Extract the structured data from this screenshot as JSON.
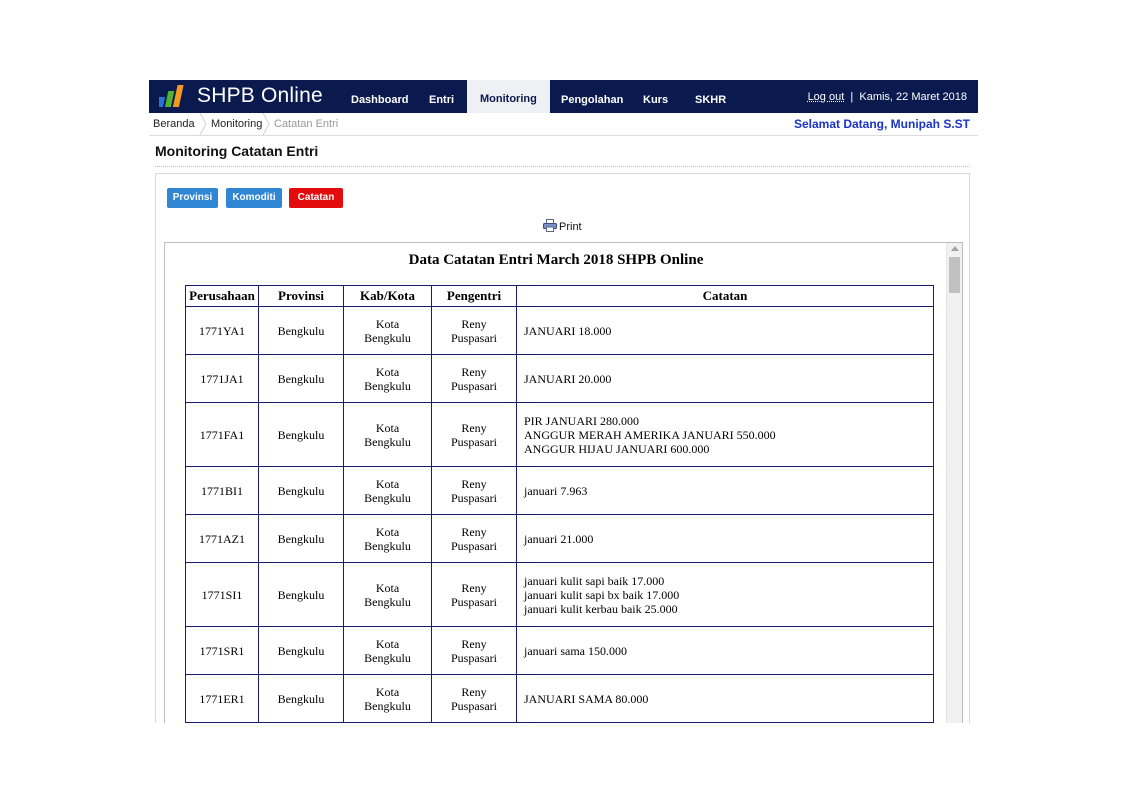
{
  "header": {
    "app_title": "SHPB Online",
    "nav": [
      "Dashboard",
      "Entri",
      "Monitoring",
      "Pengolahan",
      "Kurs",
      "SKHR"
    ],
    "active_nav": "Monitoring",
    "logout_label": "Log out",
    "separator": "|",
    "date": "Kamis, 22 Maret 2018"
  },
  "breadcrumb": [
    "Beranda",
    "Monitoring",
    "Catatan Entri"
  ],
  "welcome": "Selamat Datang, Munipah S.ST",
  "page_title": "Monitoring Catatan Entri",
  "tabs": [
    {
      "label": "Provinsi",
      "color": "#2f86d3"
    },
    {
      "label": "Komoditi",
      "color": "#2f86d3"
    },
    {
      "label": "Catatan",
      "color": "#e30b0b"
    }
  ],
  "print_label": "Print",
  "report": {
    "title": "Data Catatan Entri March 2018 SHPB Online",
    "columns": [
      "Perusahaan",
      "Provinsi",
      "Kab/Kota",
      "Pengentri",
      "Catatan"
    ],
    "rows": [
      {
        "perusahaan": "1771YA1",
        "provinsi": "Bengkulu",
        "kota": [
          "Kota",
          "Bengkulu"
        ],
        "pengentri": [
          "Reny",
          "Puspasari"
        ],
        "catatan": [
          "JANUARI 18.000"
        ]
      },
      {
        "perusahaan": "1771JA1",
        "provinsi": "Bengkulu",
        "kota": [
          "Kota",
          "Bengkulu"
        ],
        "pengentri": [
          "Reny",
          "Puspasari"
        ],
        "catatan": [
          "JANUARI 20.000"
        ]
      },
      {
        "perusahaan": "1771FA1",
        "provinsi": "Bengkulu",
        "kota": [
          "Kota",
          "Bengkulu"
        ],
        "pengentri": [
          "Reny",
          "Puspasari"
        ],
        "catatan": [
          "PIR JANUARI 280.000",
          "ANGGUR MERAH AMERIKA JANUARI 550.000",
          "ANGGUR HIJAU JANUARI 600.000"
        ]
      },
      {
        "perusahaan": "1771BI1",
        "provinsi": "Bengkulu",
        "kota": [
          "Kota",
          "Bengkulu"
        ],
        "pengentri": [
          "Reny",
          "Puspasari"
        ],
        "catatan": [
          "januari 7.963"
        ]
      },
      {
        "perusahaan": "1771AZ1",
        "provinsi": "Bengkulu",
        "kota": [
          "Kota",
          "Bengkulu"
        ],
        "pengentri": [
          "Reny",
          "Puspasari"
        ],
        "catatan": [
          "januari 21.000"
        ]
      },
      {
        "perusahaan": "1771SI1",
        "provinsi": "Bengkulu",
        "kota": [
          "Kota",
          "Bengkulu"
        ],
        "pengentri": [
          "Reny",
          "Puspasari"
        ],
        "catatan": [
          "januari kulit sapi baik 17.000",
          "januari kulit sapi bx baik 17.000",
          "januari kulit kerbau baik 25.000"
        ]
      },
      {
        "perusahaan": "1771SR1",
        "provinsi": "Bengkulu",
        "kota": [
          "Kota",
          "Bengkulu"
        ],
        "pengentri": [
          "Reny",
          "Puspasari"
        ],
        "catatan": [
          "januari sama 150.000"
        ]
      },
      {
        "perusahaan": "1771ER1",
        "provinsi": "Bengkulu",
        "kota": [
          "Kota",
          "Bengkulu"
        ],
        "pengentri": [
          "Reny",
          "Puspasari"
        ],
        "catatan": [
          "JANUARI SAMA 80.000"
        ]
      }
    ]
  }
}
